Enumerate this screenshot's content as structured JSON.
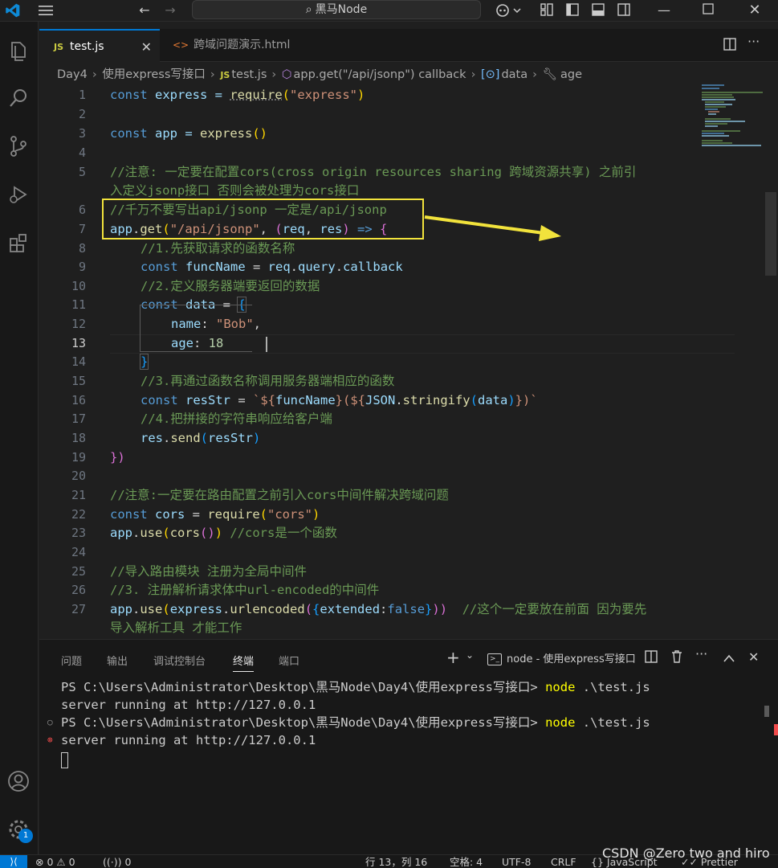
{
  "titlebar": {
    "search_text": "黑马Node"
  },
  "tabs": [
    {
      "icon_text": "JS",
      "label": "test.js",
      "active": true
    },
    {
      "icon_text": "<>",
      "label": "跨域问题演示.html",
      "active": false
    }
  ],
  "breadcrumb": {
    "items": [
      "Day4",
      "使用express写接口",
      "test.js",
      "app.get(\"/api/jsonp\") callback",
      "data",
      "age"
    ],
    "js_icon_text": "JS"
  },
  "editor": {
    "current_line": 13,
    "line_numbers": [
      "1",
      "2",
      "3",
      "4",
      "5",
      "6",
      "7",
      "8",
      "9",
      "10",
      "11",
      "12",
      "13",
      "14",
      "15",
      "16",
      "17",
      "18",
      "19",
      "20",
      "21",
      "22",
      "23",
      "24",
      "25",
      "26",
      "27"
    ],
    "lines": [
      [
        "const",
        " express = ",
        "require",
        "(",
        "\"express\"",
        ")"
      ],
      [
        "const",
        " app = ",
        "express",
        "()"
      ],
      [
        "//注意: 一定要在配置cors(cross origin resources sharing 跨域资源共享) 之前引"
      ],
      [
        "入定义jsonp接口 否则会被处理为cors接口"
      ],
      [
        "//千万不要写出api/jsonp 一定是/api/jsonp"
      ],
      [
        "app",
        ".",
        "get",
        "(",
        "\"/api/jsonp\"",
        ", ",
        "(",
        "req",
        ", ",
        "res",
        ") ",
        "=>",
        " {"
      ],
      [
        "//1.先获取请求的函数名称"
      ],
      [
        "const",
        " funcName",
        " = ",
        "req",
        ".",
        "query",
        ".",
        "callback"
      ],
      [
        "//2.定义服务器端要返回的数据"
      ],
      [
        "const",
        " data",
        " = ",
        "{"
      ],
      [
        "name",
        ": ",
        "\"Bob\"",
        ","
      ],
      [
        "age",
        ": ",
        "18"
      ],
      [
        "}"
      ],
      [
        "//3.再通过函数名称调用服务器端相应的函数"
      ],
      [
        "const",
        " resStr",
        " = ",
        "`${",
        "funcName",
        "}(${",
        "JSON",
        ".",
        "stringify",
        "(",
        "data",
        ")",
        "})`"
      ],
      [
        "//4.把拼接的字符串响应给客户端"
      ],
      [
        "res",
        ".",
        "send",
        "(",
        "resStr",
        ")"
      ],
      [
        "})"
      ],
      [
        "//注意:一定要在路由配置之前引入cors中间件解决跨域问题"
      ],
      [
        "const",
        " cors",
        " = ",
        "require",
        "(",
        "\"cors\"",
        ")"
      ],
      [
        "app",
        ".",
        "use",
        "(",
        "cors",
        "()",
        ") ",
        "//cors是一个函数"
      ],
      [
        "//导入路由模块 注册为全局中间件"
      ],
      [
        "//3. 注册解析请求体中url-encoded的中间件"
      ],
      [
        "app",
        ".",
        "use",
        "(",
        "express",
        ".",
        "urlencoded",
        "(",
        "{",
        "extended",
        ":",
        "false",
        "}",
        "))",
        "  //这个一定要放在前面 因为要先"
      ],
      [
        "导入解析工具 才能工作"
      ]
    ]
  },
  "panel": {
    "tabs": [
      "问题",
      "输出",
      "调试控制台",
      "终端",
      "端口"
    ],
    "active_tab": "终端",
    "terminal_label": "node - 使用express写接口",
    "terminal_lines": [
      {
        "prompt": "PS C:\\Users\\Administrator\\Desktop\\黑马Node\\Day4\\使用express写接口> ",
        "cmd": "node",
        "args": " .\\test.js"
      },
      {
        "text": "server running at http://127.0.0.1"
      },
      {
        "prompt": "PS C:\\Users\\Administrator\\Desktop\\黑马Node\\Day4\\使用express写接口> ",
        "cmd": "node",
        "args": " .\\test.js"
      },
      {
        "text": "server running at http://127.0.0.1"
      }
    ]
  },
  "status": {
    "errors": "0",
    "warnings": "0",
    "ports": "0",
    "position": "行 13，列 16",
    "spaces": "空格: 4",
    "encoding": "UTF-8",
    "eol": "CRLF",
    "language": "JavaScript",
    "formatter": "Prettier"
  },
  "activity": {
    "badge_count": "1"
  },
  "watermark": "CSDN @Zero two and hiro",
  "colors": {
    "accent": "#0078d4",
    "highlight_box": "#f2e33c",
    "error": "#f14c4c"
  }
}
